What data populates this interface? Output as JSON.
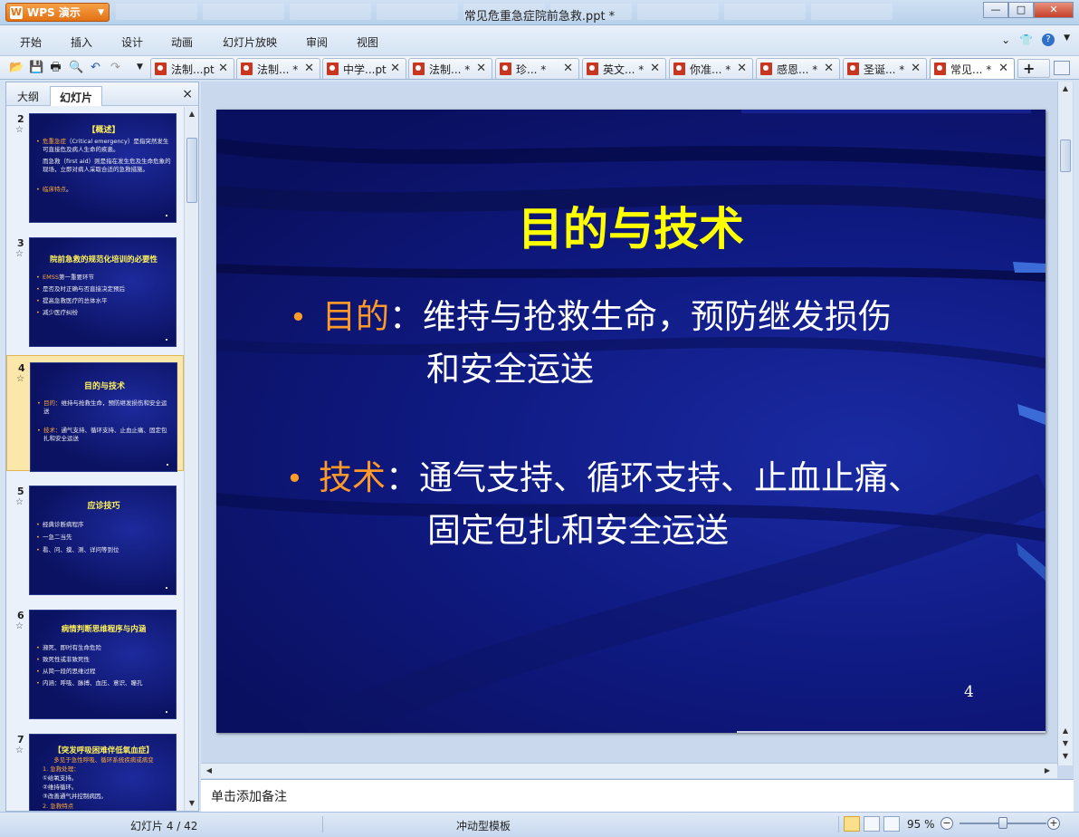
{
  "app": {
    "brand_label": "WPS 演示",
    "window_title": "常见危重急症院前急救.ppt *",
    "window_controls": {
      "minimize": "—",
      "maximize": "□",
      "close": "✕"
    }
  },
  "menu": {
    "items": [
      "开始",
      "插入",
      "设计",
      "动画",
      "幻灯片放映",
      "审阅",
      "视图"
    ]
  },
  "toolbar": {
    "icons": [
      "open-folder-icon",
      "save-icon",
      "print-icon",
      "print-preview-icon",
      "undo-icon",
      "redo-icon",
      "customize-icon"
    ],
    "doc_tabs": [
      {
        "label": "法制...pt",
        "active": false
      },
      {
        "label": "法制... *",
        "active": false
      },
      {
        "label": "中学...pt",
        "active": false
      },
      {
        "label": "法制... *",
        "active": false
      },
      {
        "label": "珍... *",
        "active": false
      },
      {
        "label": "英文... *",
        "active": false
      },
      {
        "label": "你准... *",
        "active": false
      },
      {
        "label": "感恩... *",
        "active": false
      },
      {
        "label": "圣诞... *",
        "active": false
      },
      {
        "label": "常见... *",
        "active": true
      }
    ],
    "new_tab_label": "+"
  },
  "left_pane": {
    "tabs": [
      "大纲",
      "幻灯片"
    ],
    "active_tab": "幻灯片",
    "close_label": "×",
    "thumbnails": [
      {
        "number": "2",
        "title": "【概述】",
        "lines": [
          {
            "kw": "危重急症",
            "text": "（Critical emergency）是指突然发生可直接危及病人生命的疾患。"
          },
          {
            "kw": "",
            "text": "而急救（first aid）则是指在发生危及生命危象的现场，立即对病人采取合适的急救措施。"
          },
          {
            "kw": "临床特点",
            "text": "。"
          }
        ]
      },
      {
        "number": "3",
        "title": "院前急救的规范化培训的必要性",
        "lines": [
          {
            "kw": "EMSS",
            "text": "第一重要环节"
          },
          {
            "kw": "",
            "text": "是否及时正确与否直接决定预后"
          },
          {
            "kw": "",
            "text": "提高急救医疗的总体水平"
          },
          {
            "kw": "",
            "text": "减少医疗纠纷"
          }
        ]
      },
      {
        "number": "4",
        "title": "目的与技术",
        "lines": [
          {
            "kw": "目的：",
            "text": "维持与抢救生命，预防继发损伤和安全运送"
          },
          {
            "kw": "技术：",
            "text": "通气支持、循环支持、止血止痛、固定包扎和安全运送"
          }
        ]
      },
      {
        "number": "5",
        "title": "应诊技巧",
        "lines": [
          {
            "kw": "",
            "text": "经典诊断病程序"
          },
          {
            "kw": "",
            "text": "一急二当先"
          },
          {
            "kw": "",
            "text": "看、问、摸、测、详问等到位"
          }
        ]
      },
      {
        "number": "6",
        "title": "病情判断思维程序与内涵",
        "lines": [
          {
            "kw": "",
            "text": "濒死、即时有生命危险"
          },
          {
            "kw": "",
            "text": "致死性或非致死性"
          },
          {
            "kw": "",
            "text": "从简一段的思维过程"
          },
          {
            "kw": "",
            "text": "内涵：呼吸、脉搏、血压、意识、瞳孔"
          }
        ]
      },
      {
        "number": "7",
        "title": "【突发呼吸困难伴低氧血症】",
        "subtitle": "多见于急性呼吸、循环系统疾病或病变",
        "lines": [
          {
            "kw": "",
            "text": "1. 急救处理："
          },
          {
            "kw": "",
            "text": "①给氧支持。"
          },
          {
            "kw": "",
            "text": "②维持循环。"
          },
          {
            "kw": "",
            "text": "③改善通气并控制病因。"
          },
          {
            "kw": "",
            "text": "2. 急救特点"
          }
        ]
      }
    ]
  },
  "slide": {
    "title": "目的与技术",
    "bullet_glyph": "•",
    "paragraphs": [
      {
        "keyword": "目的",
        "colon": "：",
        "line1": "维持与抢救生命，预防继发损伤",
        "line2": "和安全运送"
      },
      {
        "keyword": "技术",
        "colon": "：",
        "line1": "通气支持、循环支持、止血止痛、",
        "line2": "固定包扎和安全运送"
      }
    ],
    "page_number": "4"
  },
  "notes": {
    "placeholder": "单击添加备注"
  },
  "statusbar": {
    "slide_counter": "幻灯片 4 / 42",
    "template_name": "冲动型模板",
    "zoom_text": "95 %",
    "zoom_minus": "−",
    "zoom_plus": "+",
    "zoom_level": 0.5
  },
  "colors": {
    "slide_title": "#ffff00",
    "slide_keyword": "#ff9a2a",
    "slide_background": "#0f1a82",
    "brand_orange": "#e27214"
  }
}
